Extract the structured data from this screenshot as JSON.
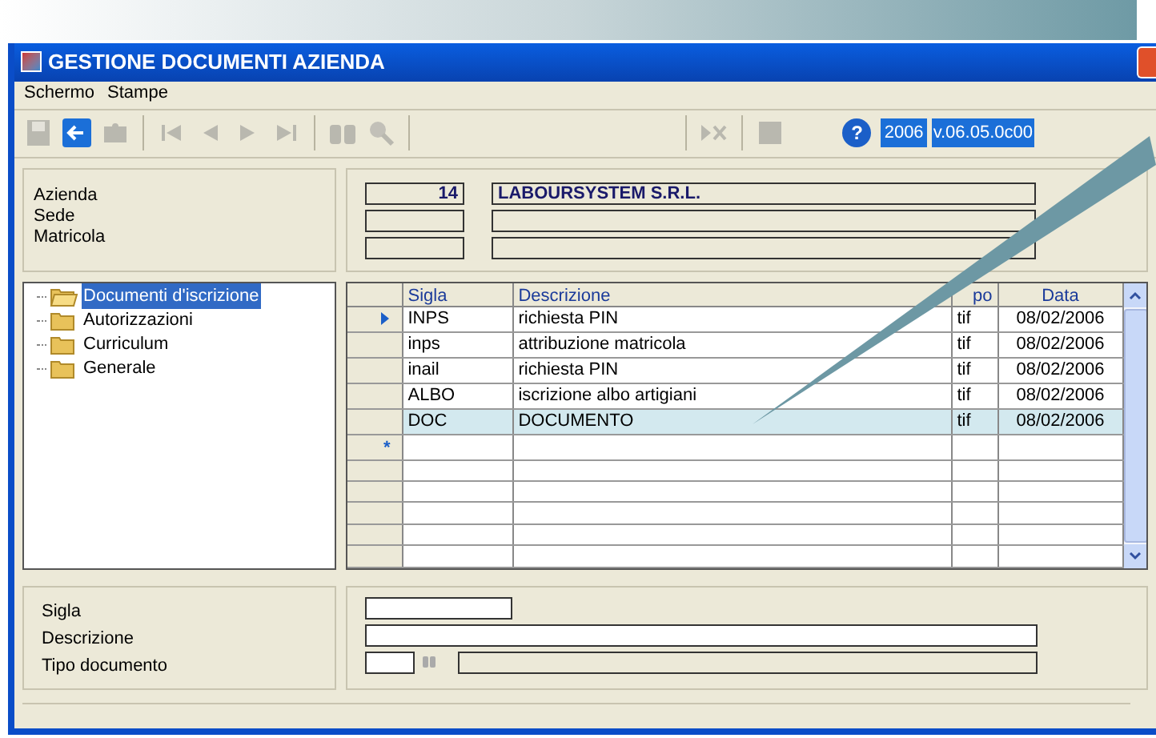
{
  "window": {
    "title": "GESTIONE DOCUMENTI AZIENDA"
  },
  "menu": [
    "Schermo",
    "Stampe"
  ],
  "toolbar": {
    "help": "?",
    "year": "2006",
    "version": "v.06.05.0c00"
  },
  "header_fields": [
    {
      "label": "Azienda",
      "code": "14",
      "name": "LABOURSYSTEM S.R.L."
    },
    {
      "label": "Sede"
    },
    {
      "label": "Matricola"
    }
  ],
  "tree": [
    {
      "label": "Documenti d'iscrizione",
      "selected": true
    },
    {
      "label": "Autorizzazioni",
      "selected": false
    },
    {
      "label": "Curriculum",
      "selected": false
    },
    {
      "label": "Generale",
      "selected": false
    }
  ],
  "table": {
    "columns": [
      "Sigla",
      "Descrizione",
      "po",
      "Data"
    ],
    "rows": [
      {
        "cells": [
          "INPS",
          "richiesta PIN",
          "tif",
          "08/02/2006"
        ],
        "current": true,
        "selected": false
      },
      {
        "cells": [
          "inps",
          "attribuzione matricola",
          "tif",
          "08/02/2006"
        ],
        "current": false,
        "selected": false
      },
      {
        "cells": [
          "inail",
          "richiesta PIN",
          "tif",
          "08/02/2006"
        ],
        "current": false,
        "selected": false
      },
      {
        "cells": [
          "ALBO",
          "iscrizione albo artigiani",
          "tif",
          "08/02/2006"
        ],
        "current": false,
        "selected": false
      },
      {
        "cells": [
          "DOC",
          "DOCUMENTO",
          "tif",
          "08/02/2006"
        ],
        "current": false,
        "selected": true
      }
    ],
    "new_row_marker": "*"
  },
  "detail_fields": [
    {
      "label": "Sigla",
      "kind": "short"
    },
    {
      "label": "Descrizione",
      "kind": "long"
    },
    {
      "label": "Tipo documento",
      "kind": "lookup"
    }
  ]
}
